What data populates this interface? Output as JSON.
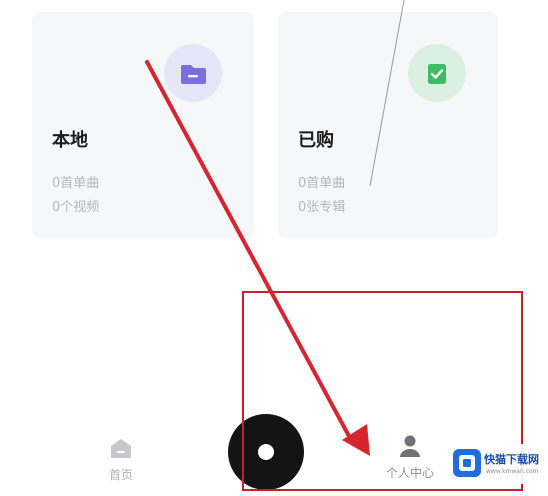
{
  "cards": [
    {
      "title": "本地",
      "lines": [
        "0首单曲",
        "0个视频"
      ],
      "icon": "folder-icon",
      "icon_color": "#7b6fe0"
    },
    {
      "title": "已购",
      "lines": [
        "0首单曲",
        "0张专辑"
      ],
      "icon": "purchased-bag-icon",
      "icon_color": "#3cbc65"
    }
  ],
  "tabbar": {
    "home_label": "首页",
    "profile_label": "个人中心",
    "center_icon": "music-disc-icon"
  },
  "annotation": {
    "box_color": "#c8202a",
    "arrow_color": "#d8242e"
  },
  "watermark": {
    "name": "快猫下载网",
    "url": "www.kmwan.com"
  }
}
